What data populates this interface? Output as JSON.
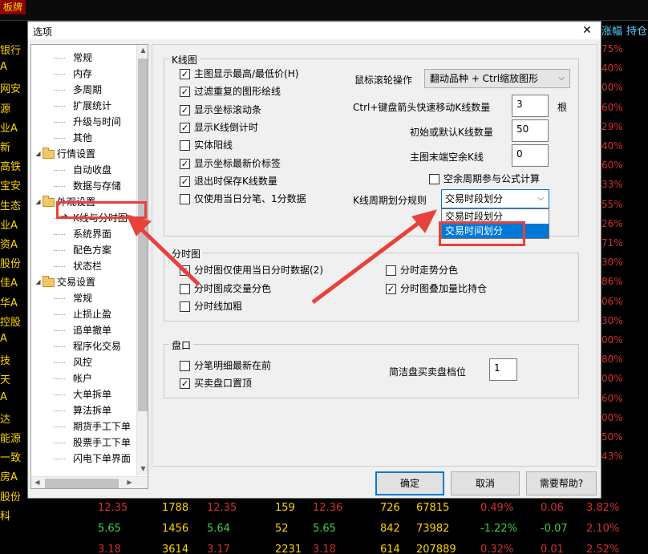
{
  "background": {
    "app_title": "板牌",
    "header_cols": [
      "涨幅",
      "持仓"
    ],
    "left_names": [
      "银行",
      "A",
      "网安",
      "源",
      "业A",
      "新",
      "高铁",
      "宝安",
      "生态",
      "业A",
      "资A",
      "股份",
      "佳A",
      "华A",
      "控股",
      "A",
      "技",
      "天",
      "A",
      "达",
      "能源",
      "一致",
      "房A",
      "股份",
      "科"
    ],
    "right_pcts": [
      "75%",
      "40%",
      "00%",
      "60%",
      "29%",
      "40%",
      "60%",
      "33%",
      "55%",
      "26%",
      "71%",
      "30%",
      "86%",
      "06%",
      "30%",
      "00%",
      "80%",
      "00%",
      "60%",
      "00%",
      "50%",
      "43%"
    ],
    "rows": [
      {
        "cells": [
          "12.35",
          "1788",
          "12.35",
          "159",
          "12.36",
          "726",
          "67815",
          "0.49%",
          "0.06",
          "3.82%"
        ]
      },
      {
        "cells": [
          "5.65",
          "1456",
          "5.64",
          "52",
          "5.65",
          "842",
          "73982",
          "-1.22%",
          "-0.07",
          "2.10%"
        ]
      },
      {
        "cells": [
          "3.18",
          "3614",
          "3.17",
          "2231",
          "3.18",
          "614",
          "207889",
          "0.32%",
          "0.01",
          "2.52%"
        ]
      }
    ]
  },
  "dialog": {
    "title": "选项",
    "tree": {
      "items": [
        {
          "type": "leaf",
          "label": "常规"
        },
        {
          "type": "leaf",
          "label": "内存"
        },
        {
          "type": "leaf",
          "label": "多周期"
        },
        {
          "type": "leaf",
          "label": "扩展统计"
        },
        {
          "type": "leaf",
          "label": "升级与时间"
        },
        {
          "type": "leaf",
          "label": "其他"
        },
        {
          "type": "group",
          "label": "行情设置"
        },
        {
          "type": "leaf",
          "label": "自动收盘"
        },
        {
          "type": "leaf",
          "label": "数据与存储"
        },
        {
          "type": "group",
          "label": "外观设置"
        },
        {
          "type": "leaf",
          "label": "K线与分时图",
          "selected": true
        },
        {
          "type": "leaf",
          "label": "系统界面"
        },
        {
          "type": "leaf",
          "label": "配色方案"
        },
        {
          "type": "leaf",
          "label": "状态栏"
        },
        {
          "type": "group",
          "label": "交易设置"
        },
        {
          "type": "leaf",
          "label": "常规"
        },
        {
          "type": "leaf",
          "label": "止损止盈"
        },
        {
          "type": "leaf",
          "label": "追单撤单"
        },
        {
          "type": "leaf",
          "label": "程序化交易"
        },
        {
          "type": "leaf",
          "label": "风控"
        },
        {
          "type": "leaf",
          "label": "帐户"
        },
        {
          "type": "leaf",
          "label": "大单拆单"
        },
        {
          "type": "leaf",
          "label": "算法拆单"
        },
        {
          "type": "leaf",
          "label": "期货手工下单"
        },
        {
          "type": "leaf",
          "label": "股票手工下单"
        },
        {
          "type": "leaf",
          "label": "闪电下单界面"
        }
      ]
    },
    "kline": {
      "title": "K线图",
      "checks": [
        {
          "label": "主图显示最高/最低价(H)",
          "checked": true
        },
        {
          "label": "过滤重复的图形绘线",
          "checked": true
        },
        {
          "label": "显示坐标滚动条",
          "checked": true
        },
        {
          "label": "显示K线倒计时",
          "checked": true
        },
        {
          "label": "实体阳线",
          "checked": false
        },
        {
          "label": "显示坐标最新价标签",
          "checked": true
        },
        {
          "label": "退出时保存K线数量",
          "checked": true
        },
        {
          "label": "仅使用当日分笔、1分数据",
          "checked": false
        }
      ],
      "mouse_scroll_label": "鼠标滚轮操作",
      "mouse_scroll_value": "翻动品种 + Ctrl缩放图形",
      "ctrl_move_label": "Ctrl+键盘箭头快速移动K线数量",
      "ctrl_move_value": "3",
      "ctrl_move_unit": "根",
      "init_count_label": "初始或默认K线数量",
      "init_count_value": "50",
      "blank_count_label": "主图末端空余K线",
      "blank_count_value": "0",
      "empty_period_label": "空余周期参与公式计算",
      "empty_period_checked": false,
      "period_rule_label": "K线周期划分规则",
      "period_rule_value": "交易时段划分",
      "period_rule_options": [
        "交易时段划分",
        "交易时间划分"
      ]
    },
    "timeshare": {
      "title": "分时图",
      "checks": [
        {
          "label": "分时图仅使用当日分时数据(2)",
          "checked": true
        },
        {
          "label": "分时图成交量分色",
          "checked": false
        },
        {
          "label": "分时线加粗",
          "checked": false
        },
        {
          "label": "分时走势分色",
          "checked": false
        },
        {
          "label": "分时图叠加量比持仓",
          "checked": true
        }
      ]
    },
    "pankou": {
      "title": "盘口",
      "checks": [
        {
          "label": "分笔明细最新在前",
          "checked": false
        },
        {
          "label": "买卖盘口置顶",
          "checked": true
        }
      ],
      "depth_label": "简洁盘买卖盘档位",
      "depth_value": "1"
    },
    "buttons": {
      "ok": "确定",
      "cancel": "取消",
      "help": "需要帮助?"
    },
    "colors": {
      "annotation": "#e8413c",
      "selection": "#0078d7"
    }
  }
}
